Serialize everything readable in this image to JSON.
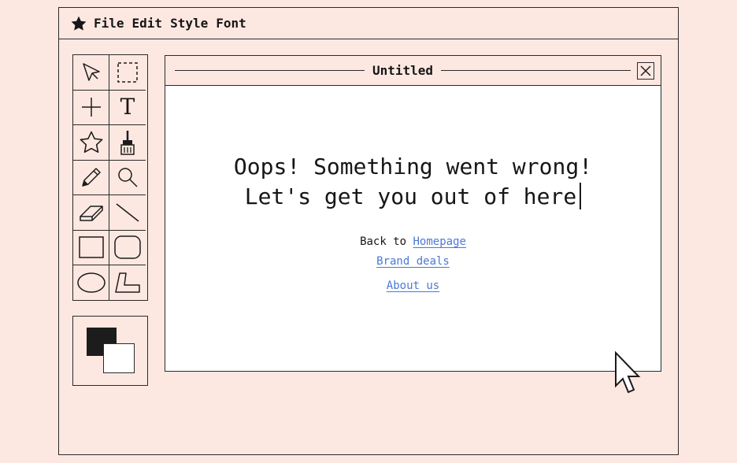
{
  "menubar": {
    "logo_icon": "star-icon",
    "items": [
      "File",
      "Edit",
      "Style",
      "Font"
    ]
  },
  "toolbox": {
    "tools": [
      {
        "name": "select-arrow-icon"
      },
      {
        "name": "marquee-select-icon"
      },
      {
        "name": "crosshair-icon"
      },
      {
        "name": "text-tool-icon",
        "glyph": "T"
      },
      {
        "name": "star-shape-icon"
      },
      {
        "name": "paint-brush-icon"
      },
      {
        "name": "pencil-icon"
      },
      {
        "name": "magnifier-icon"
      },
      {
        "name": "eraser-icon"
      },
      {
        "name": "line-icon"
      },
      {
        "name": "rectangle-icon"
      },
      {
        "name": "rounded-rectangle-icon"
      },
      {
        "name": "ellipse-icon"
      },
      {
        "name": "polygon-icon"
      }
    ],
    "colors": {
      "foreground": "#1c1c1c",
      "background": "#ffffff"
    }
  },
  "document": {
    "title": "Untitled",
    "headline_line1": "Oops! Something went wrong!",
    "headline_line2": "Let's get you out of here",
    "back_prefix": "Back to ",
    "homepage_link": "Homepage",
    "brand_link": "Brand deals",
    "about_link": "About us"
  },
  "theme": {
    "background": "#fde8e1",
    "border": "#2a2a2a",
    "link": "#4b78d6"
  }
}
